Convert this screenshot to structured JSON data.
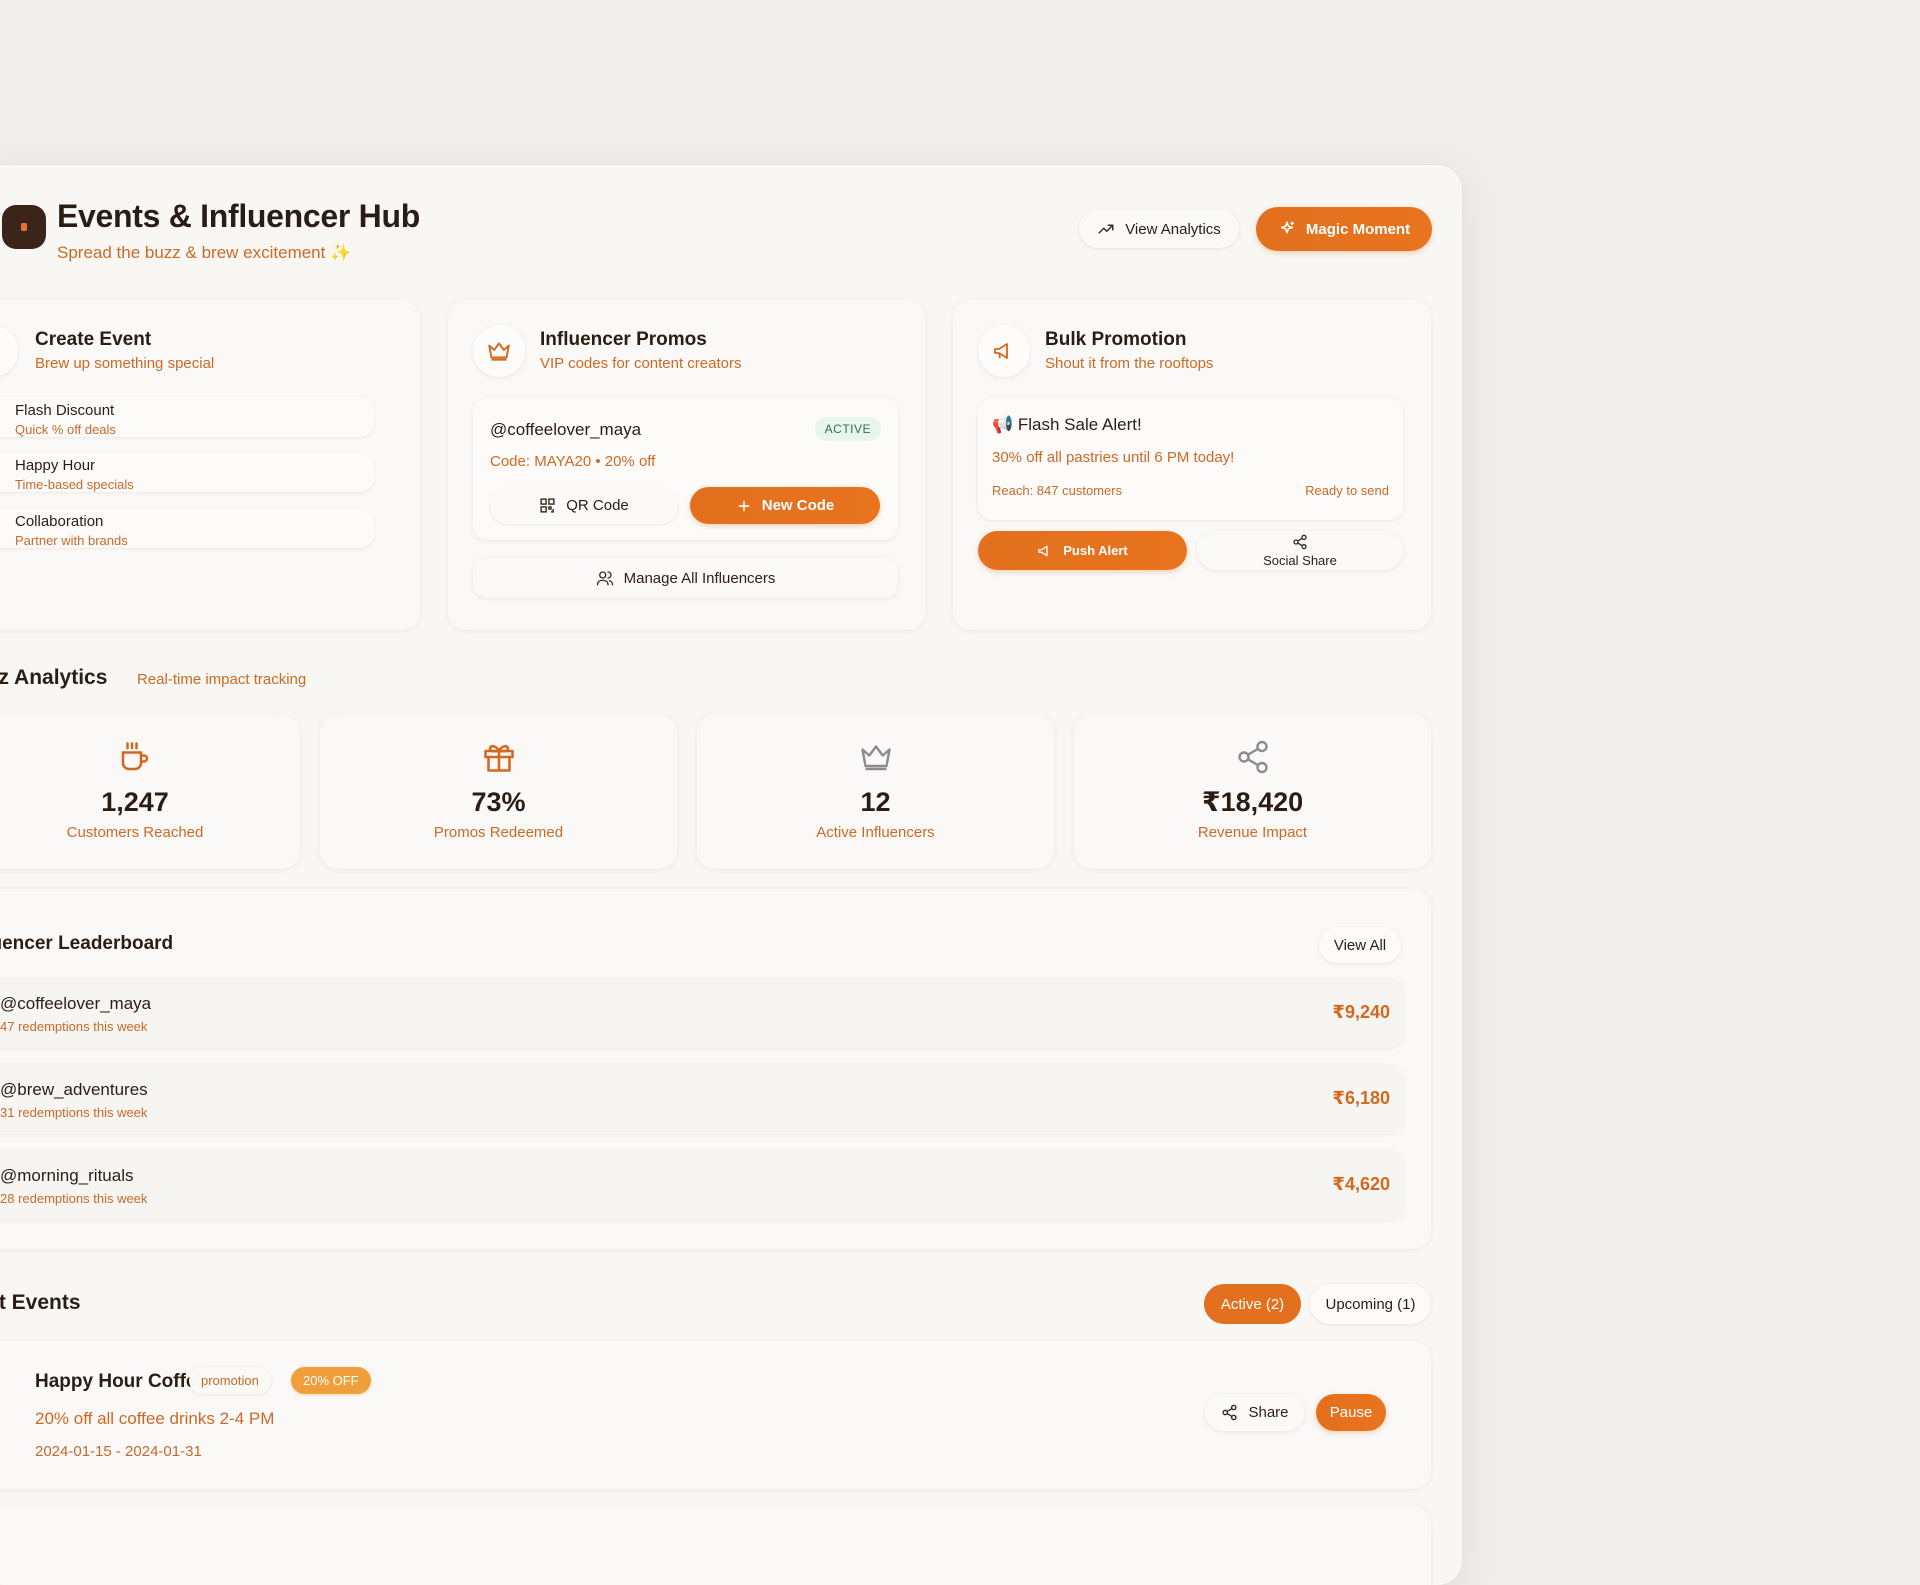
{
  "header": {
    "title": "Events & Influencer Hub",
    "subtitle": "Spread the buzz & brew excitement ✨",
    "view_analytics": "View Analytics",
    "magic_moment": "Magic Moment"
  },
  "create_event": {
    "title": "Create Event",
    "subtitle": "Brew up something special",
    "items": [
      {
        "title": "Flash Discount",
        "sub": "Quick % off deals"
      },
      {
        "title": "Happy Hour",
        "sub": "Time-based specials"
      },
      {
        "title": "Collaboration",
        "sub": "Partner with brands"
      }
    ]
  },
  "influencer_promos": {
    "title": "Influencer Promos",
    "subtitle": "VIP codes for content creators",
    "handle": "@coffeelover_maya",
    "status": "ACTIVE",
    "code": "Code: MAYA20 • 20% off",
    "qr_label": "QR Code",
    "new_code_label": "New Code",
    "manage_label": "Manage All Influencers"
  },
  "bulk_promotion": {
    "title": "Bulk Promotion",
    "subtitle": "Shout it from the rooftops",
    "alert_title": "📢 Flash Sale Alert!",
    "alert_body": "30% off all pastries until 6 PM today!",
    "reach": "Reach: 847 customers",
    "ready": "Ready to send",
    "push_label": "Push Alert",
    "social_label": "Social Share"
  },
  "analytics": {
    "title": "Buzz Analytics",
    "subtitle": "Real-time impact tracking",
    "stats": [
      {
        "value": "1,247",
        "label": "Customers Reached",
        "icon": "coffee-cup-icon"
      },
      {
        "value": "73%",
        "label": "Promos Redeemed",
        "icon": "gift-icon"
      },
      {
        "value": "12",
        "label": "Active Influencers",
        "icon": "crown-icon"
      },
      {
        "value": "₹18,420",
        "label": "Revenue Impact",
        "icon": "share-icon"
      }
    ]
  },
  "leaderboard": {
    "title": "Influencer Leaderboard",
    "view_all": "View All",
    "rows": [
      {
        "handle": "@coffeelover_maya",
        "sub": "47 redemptions this week",
        "amount": "₹9,240"
      },
      {
        "handle": "@brew_adventures",
        "sub": "31 redemptions this week",
        "amount": "₹6,180"
      },
      {
        "handle": "@morning_rituals",
        "sub": "28 redemptions this week",
        "amount": "₹4,620"
      }
    ]
  },
  "current_events": {
    "title": "Current Events",
    "tab_active": "Active (2)",
    "tab_upcoming": "Upcoming (1)",
    "events": [
      {
        "name": "Happy Hour Coffee",
        "tag": "promotion",
        "discount": "20% OFF",
        "desc": "20% off all coffee drinks 2-4 PM",
        "dates": "2024-01-15 - 2024-01-31",
        "share_label": "Share",
        "pause_label": "Pause"
      }
    ]
  },
  "colors": {
    "accent": "#e3701e",
    "accent_text": "#cc6a24",
    "dark": "#2b1d14",
    "background": "#f8f7f4"
  }
}
